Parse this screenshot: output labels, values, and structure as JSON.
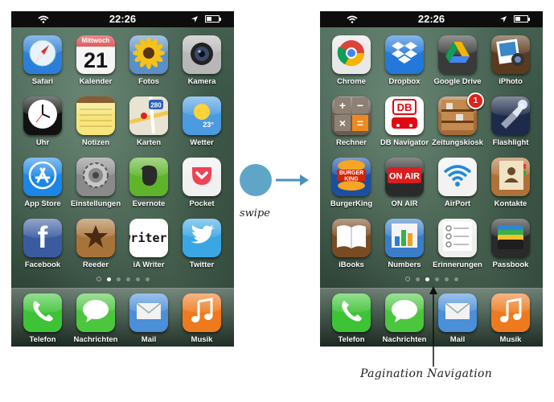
{
  "status": {
    "time": "22:26"
  },
  "screen_left": {
    "apps": [
      {
        "name": "Safari",
        "icon": "safari-icon",
        "bg": "#2c7fd8"
      },
      {
        "name": "Kalender",
        "icon": "calendar-icon",
        "bg": "#f4f4f4",
        "month": "Mittwoch",
        "day": "21"
      },
      {
        "name": "Fotos",
        "icon": "sunflower-icon",
        "bg": "#5a8fc8"
      },
      {
        "name": "Kamera",
        "icon": "camera-icon",
        "bg": "#b7b7b7"
      },
      {
        "name": "Uhr",
        "icon": "clock-icon",
        "bg": "#111111"
      },
      {
        "name": "Notizen",
        "icon": "notes-icon",
        "bg": "#f6e57c"
      },
      {
        "name": "Karten",
        "icon": "maps-icon",
        "bg": "#e8e3d3",
        "shield": "280"
      },
      {
        "name": "Wetter",
        "icon": "weather-icon",
        "bg": "#4b9be0",
        "temp": "23°"
      },
      {
        "name": "App Store",
        "icon": "app-store-icon",
        "bg": "#1b86e6"
      },
      {
        "name": "Einstellungen",
        "icon": "settings-gear-icon",
        "bg": "#8a8a8a"
      },
      {
        "name": "Evernote",
        "icon": "evernote-icon",
        "bg": "#5eb42a"
      },
      {
        "name": "Pocket",
        "icon": "pocket-icon",
        "bg": "#f0f0f0"
      },
      {
        "name": "Facebook",
        "icon": "facebook-icon",
        "bg": "#3b5ba0",
        "glyph": "f"
      },
      {
        "name": "Reeder",
        "icon": "reeder-star-icon",
        "bg": "#a8733a"
      },
      {
        "name": "iA Writer",
        "icon": "writer-icon",
        "bg": "#ffffff",
        "glyph": "writer"
      },
      {
        "name": "Twitter",
        "icon": "twitter-bird-icon",
        "bg": "#3aa6e4"
      }
    ],
    "dock": [
      {
        "name": "Telefon",
        "icon": "phone-icon",
        "bg": "#3ec337"
      },
      {
        "name": "Nachrichten",
        "icon": "messages-icon",
        "bg": "#4cc63f"
      },
      {
        "name": "Mail",
        "icon": "mail-icon",
        "bg": "#4a8fd8"
      },
      {
        "name": "Musik",
        "icon": "music-icon",
        "bg": "#ee7a1d"
      }
    ],
    "active_page": 1
  },
  "screen_right": {
    "apps": [
      {
        "name": "Chrome",
        "icon": "chrome-icon",
        "bg": "#e8e8e8"
      },
      {
        "name": "Dropbox",
        "icon": "dropbox-icon",
        "bg": "#2378d9"
      },
      {
        "name": "Google Drive",
        "icon": "google-drive-icon",
        "bg": "#3a3a3a"
      },
      {
        "name": "iPhoto",
        "icon": "iphoto-icon",
        "bg": "#5a3b1f"
      },
      {
        "name": "Rechner",
        "icon": "calculator-icon",
        "bg": "#6a5c4f"
      },
      {
        "name": "DB Navigator",
        "icon": "db-navigator-icon",
        "bg": "#ffffff",
        "glyph": "DB"
      },
      {
        "name": "Zeitungskiosk",
        "icon": "newsstand-icon",
        "bg": "#a36b38",
        "badge": "1"
      },
      {
        "name": "Flashlight",
        "icon": "flashlight-icon",
        "bg": "#1d2a4a"
      },
      {
        "name": "BurgerKing",
        "icon": "burger-king-icon",
        "bg": "#1a4fa3",
        "glyph": "BURGER KING"
      },
      {
        "name": "ON AIR",
        "icon": "on-air-icon",
        "bg": "#2a2a2a",
        "glyph": "ON AIR"
      },
      {
        "name": "AirPort",
        "icon": "airport-wifi-icon",
        "bg": "#f2f2f2"
      },
      {
        "name": "Kontakte",
        "icon": "contacts-icon",
        "bg": "#b0703a"
      },
      {
        "name": "iBooks",
        "icon": "ibooks-icon",
        "bg": "#7a4b22"
      },
      {
        "name": "Numbers",
        "icon": "numbers-chart-icon",
        "bg": "#3a7ec9"
      },
      {
        "name": "Erinnerungen",
        "icon": "reminders-icon",
        "bg": "#eeeeee"
      },
      {
        "name": "Passbook",
        "icon": "passbook-icon",
        "bg": "#2a2a2a"
      }
    ],
    "dock": [
      {
        "name": "Telefon",
        "icon": "phone-icon",
        "bg": "#3ec337"
      },
      {
        "name": "Nachrichten",
        "icon": "messages-icon",
        "bg": "#4cc63f"
      },
      {
        "name": "Mail",
        "icon": "mail-icon",
        "bg": "#4a8fd8"
      },
      {
        "name": "Musik",
        "icon": "music-icon",
        "bg": "#ee7a1d"
      }
    ],
    "active_page": 2
  },
  "annotations": {
    "swipe": "swipe",
    "pagination": "Pagination Navigation",
    "circle_color": "#5fa5c8"
  }
}
